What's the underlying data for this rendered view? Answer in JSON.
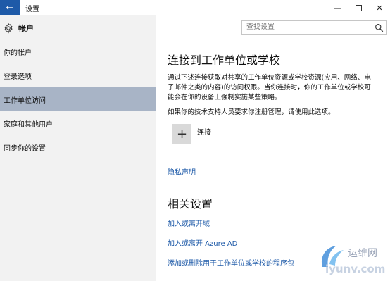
{
  "window": {
    "title": "设置",
    "back_glyph": "←",
    "minimize_glyph": "—",
    "close_glyph": "✕"
  },
  "sidebar": {
    "header": "帐户",
    "items": [
      {
        "label": "你的帐户"
      },
      {
        "label": "登录选项"
      },
      {
        "label": "工作单位访问",
        "active": true
      },
      {
        "label": "家庭和其他用户"
      },
      {
        "label": "同步你的设置"
      }
    ]
  },
  "search": {
    "placeholder": "查找设置"
  },
  "main": {
    "title": "连接到工作单位或学校",
    "description": "通过下述连接获取对共享的工作单位资源或学校资源(应用、网络、电子邮件之类的内容)的访问权限。当你连接时，你的工作单位或学校可能会在你的设备上强制实施某些策略。",
    "description2": "如果你的技术支持人员要求你注册管理，请使用此选项。",
    "connect_symbol": "+",
    "connect_label": "连接",
    "privacy_link": "隐私声明",
    "related_title": "相关设置",
    "related_links": [
      "加入或离开域",
      "加入或离开 Azure AD",
      "添加或删除用于工作单位或学校的程序包"
    ]
  },
  "colors": {
    "accent": "#1e5aa8",
    "sidebar_bg": "#f2f2f2",
    "active_item": "#a8b4c6",
    "tile": "#d9d9d9"
  },
  "watermark": {
    "brand": "运维网",
    "domain": "iyunv.com"
  }
}
